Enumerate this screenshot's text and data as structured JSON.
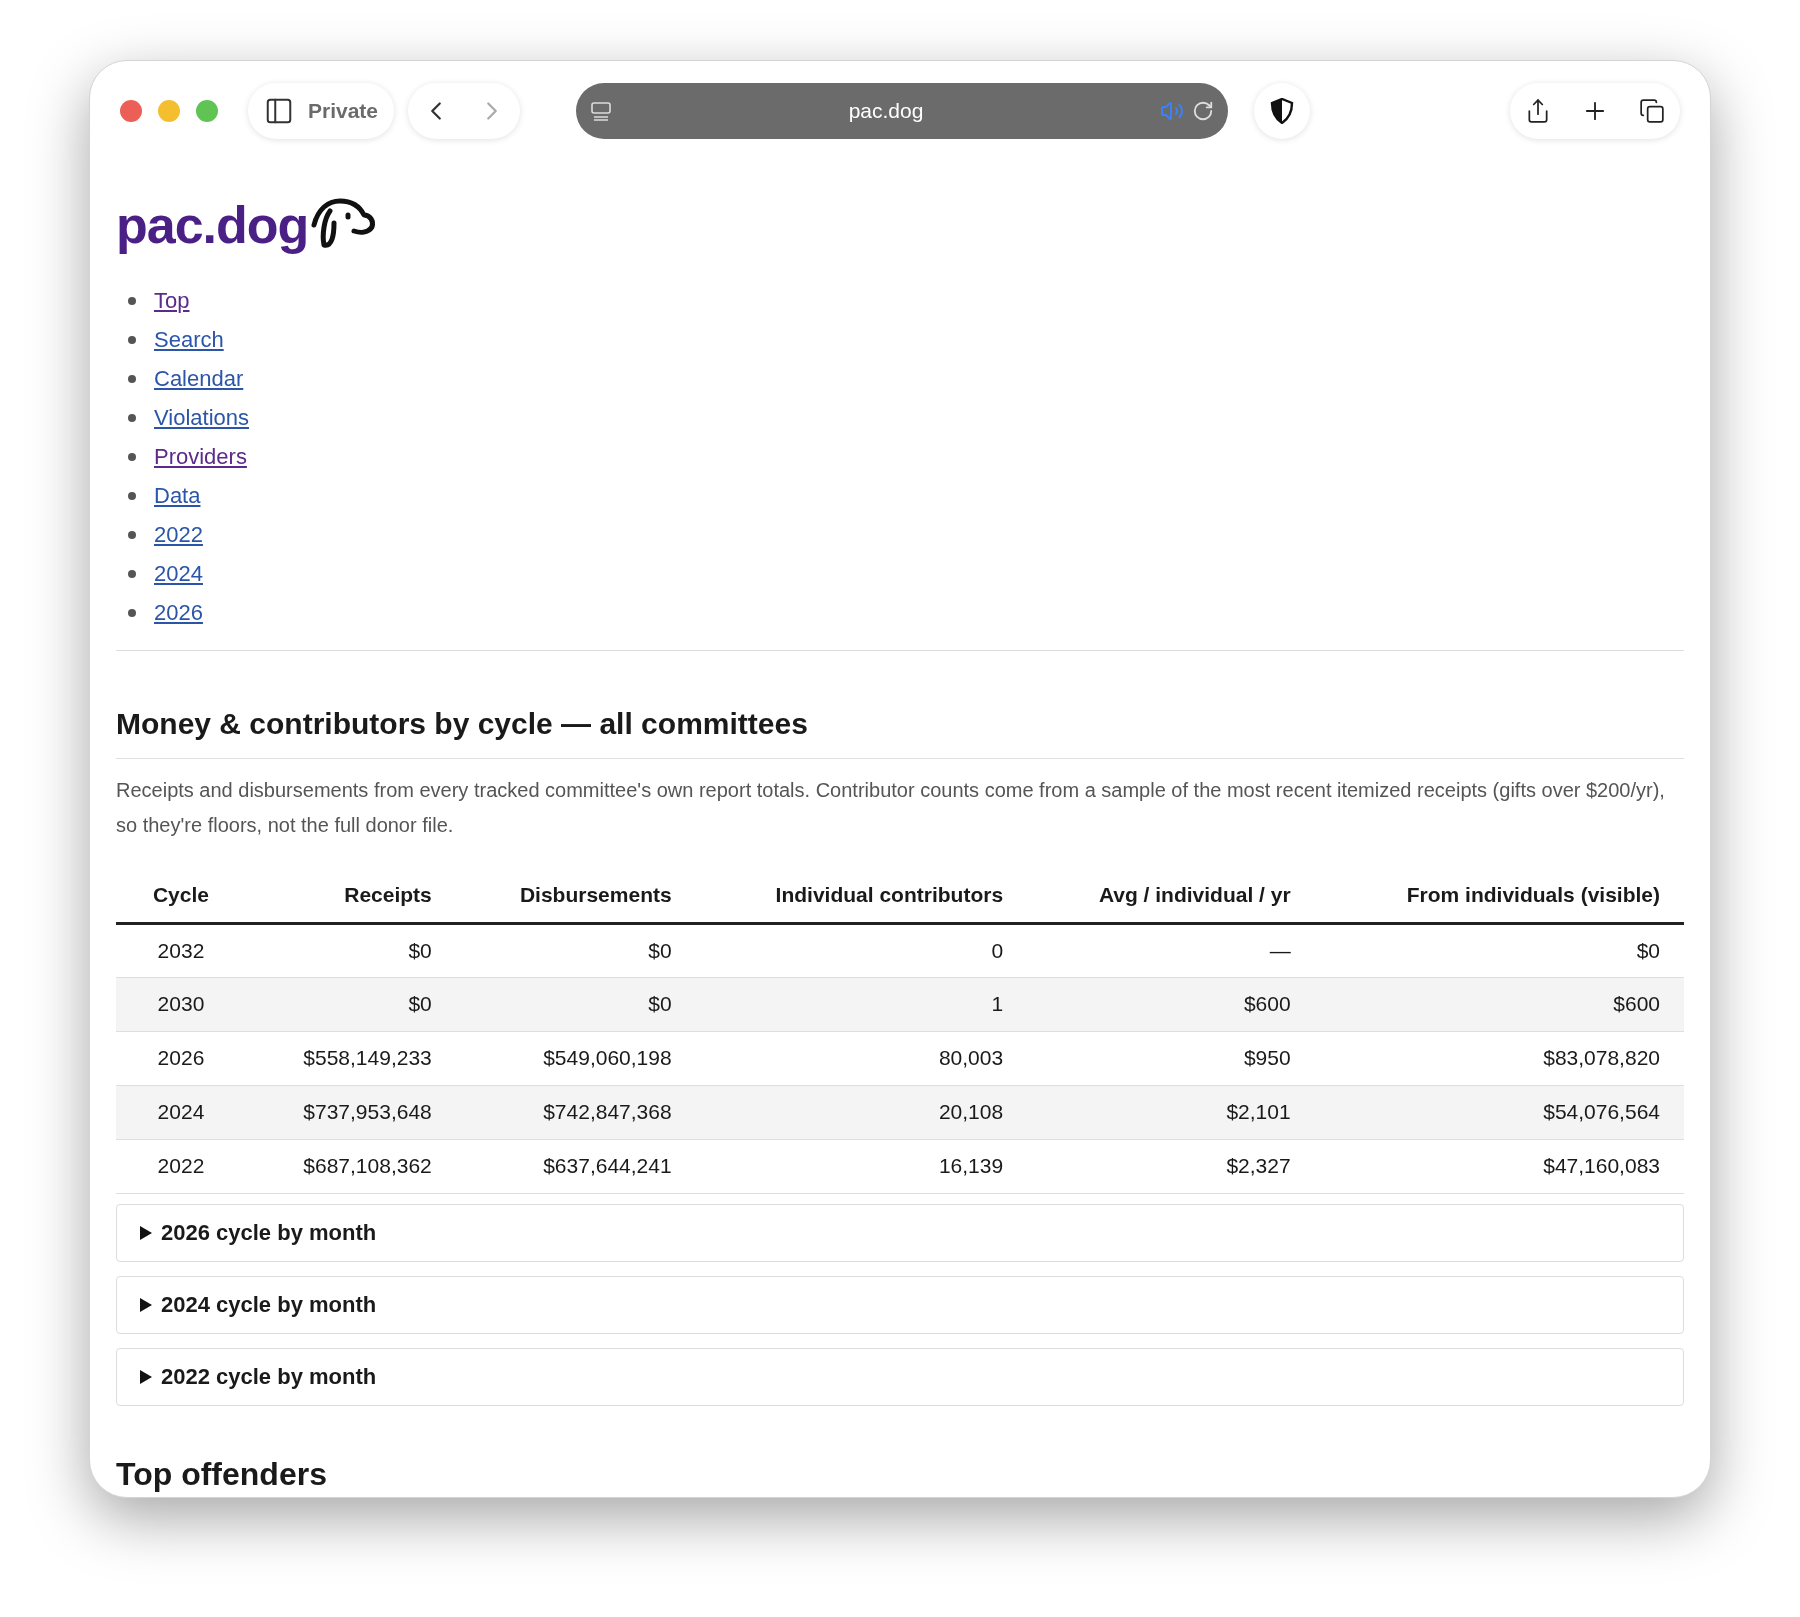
{
  "browser": {
    "mode_label": "Private",
    "address": "pac.dog"
  },
  "logo": {
    "text": "pac.dog"
  },
  "nav": [
    {
      "label": "Top",
      "visited": true
    },
    {
      "label": "Search",
      "visited": false
    },
    {
      "label": "Calendar",
      "visited": false
    },
    {
      "label": "Violations",
      "visited": false
    },
    {
      "label": "Providers",
      "visited": true
    },
    {
      "label": "Data",
      "visited": false
    },
    {
      "label": "2022",
      "visited": false
    },
    {
      "label": "2024",
      "visited": false
    },
    {
      "label": "2026",
      "visited": false
    }
  ],
  "section": {
    "title": "Money & contributors by cycle — all committees",
    "description": "Receipts and disbursements from every tracked committee's own report totals. Contributor counts come from a sample of the most recent itemized receipts (gifts over $200/yr), so they're floors, not the full donor file."
  },
  "table": {
    "columns": [
      "Cycle",
      "Receipts",
      "Disbursements",
      "Individual contributors",
      "Avg / individual / yr",
      "From individuals (visible)"
    ],
    "rows": [
      [
        "2032",
        "$0",
        "$0",
        "0",
        "—",
        "$0"
      ],
      [
        "2030",
        "$0",
        "$0",
        "1",
        "$600",
        "$600"
      ],
      [
        "2026",
        "$558,149,233",
        "$549,060,198",
        "80,003",
        "$950",
        "$83,078,820"
      ],
      [
        "2024",
        "$737,953,648",
        "$742,847,368",
        "20,108",
        "$2,101",
        "$54,076,564"
      ],
      [
        "2022",
        "$687,108,362",
        "$637,644,241",
        "16,139",
        "$2,327",
        "$47,160,083"
      ]
    ]
  },
  "details": [
    {
      "label": "2026 cycle by month",
      "expanded": false
    },
    {
      "label": "2024 cycle by month",
      "expanded": false
    },
    {
      "label": "2022 cycle by month",
      "expanded": false
    }
  ],
  "next_heading": "Top offenders"
}
